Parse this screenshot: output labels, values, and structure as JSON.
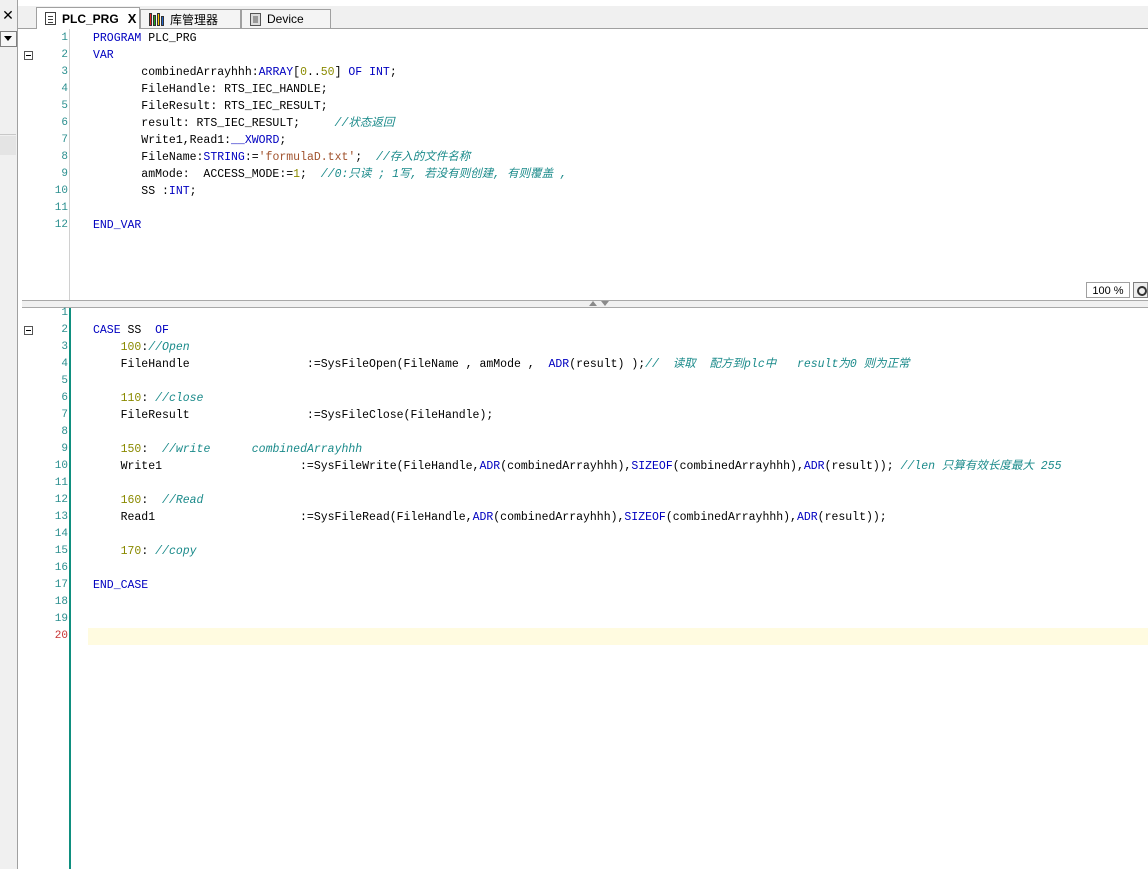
{
  "tabs": [
    {
      "label": "PLC_PRG",
      "active": true,
      "icon": "document-icon",
      "closable": true
    },
    {
      "label": "库管理器",
      "active": false,
      "icon": "library-icon"
    },
    {
      "label": "Device",
      "active": false,
      "icon": "device-icon"
    }
  ],
  "tab_close_symbol": "X",
  "left_close_symbol": "✕",
  "zoom_label": "100 %",
  "decl_lines": [
    {
      "n": "1",
      "tokens": [
        {
          "t": "PROGRAM",
          "c": "kw"
        },
        {
          "t": " PLC_PRG"
        }
      ]
    },
    {
      "n": "2",
      "fold": true,
      "tokens": [
        {
          "t": "VAR",
          "c": "kw"
        }
      ]
    },
    {
      "n": "3",
      "tokens": [
        {
          "t": "       combinedArrayhhh:"
        },
        {
          "t": "ARRAY",
          "c": "kw"
        },
        {
          "t": "["
        },
        {
          "t": "0",
          "c": "num"
        },
        {
          "t": ".."
        },
        {
          "t": "50",
          "c": "num"
        },
        {
          "t": "] "
        },
        {
          "t": "OF INT",
          "c": "kw"
        },
        {
          "t": ";"
        }
      ]
    },
    {
      "n": "4",
      "tokens": [
        {
          "t": "       FileHandle: RTS_IEC_HANDLE;"
        }
      ]
    },
    {
      "n": "5",
      "tokens": [
        {
          "t": "       FileResult: RTS_IEC_RESULT;"
        }
      ]
    },
    {
      "n": "6",
      "tokens": [
        {
          "t": "       result: RTS_IEC_RESULT;     "
        },
        {
          "t": "//状态返回",
          "c": "cm"
        }
      ]
    },
    {
      "n": "7",
      "tokens": [
        {
          "t": "       Write1,Read1:"
        },
        {
          "t": "__XWORD",
          "c": "kw"
        },
        {
          "t": ";"
        }
      ]
    },
    {
      "n": "8",
      "tokens": [
        {
          "t": "       FileName:"
        },
        {
          "t": "STRING",
          "c": "kw"
        },
        {
          "t": ":="
        },
        {
          "t": "'formulaD.txt'",
          "c": "str"
        },
        {
          "t": ";  "
        },
        {
          "t": "//存入的文件名称",
          "c": "cm"
        }
      ]
    },
    {
      "n": "9",
      "tokens": [
        {
          "t": "       amMode:  ACCESS_MODE:="
        },
        {
          "t": "1",
          "c": "num"
        },
        {
          "t": ";  "
        },
        {
          "t": "//0:只读 ; 1写, 若没有则创建, 有则覆盖 ,",
          "c": "cm"
        }
      ]
    },
    {
      "n": "10",
      "tokens": [
        {
          "t": "       SS :"
        },
        {
          "t": "INT",
          "c": "kw"
        },
        {
          "t": ";"
        }
      ]
    },
    {
      "n": "11",
      "tokens": []
    },
    {
      "n": "12",
      "tokens": [
        {
          "t": "END_VAR",
          "c": "kw"
        }
      ]
    }
  ],
  "impl_lines": [
    {
      "n": "1",
      "tokens": []
    },
    {
      "n": "2",
      "fold": true,
      "tokens": [
        {
          "t": "CASE",
          "c": "kw"
        },
        {
          "t": " SS  "
        },
        {
          "t": "OF",
          "c": "kw"
        }
      ]
    },
    {
      "n": "3",
      "tokens": [
        {
          "t": "    "
        },
        {
          "t": "100",
          "c": "num"
        },
        {
          "t": ":"
        },
        {
          "t": "//Open",
          "c": "cm"
        }
      ]
    },
    {
      "n": "4",
      "tokens": [
        {
          "t": "    FileHandle                 :=SysFileOpen(FileName , amMode ,  "
        },
        {
          "t": "ADR",
          "c": "kw"
        },
        {
          "t": "(result) );"
        },
        {
          "t": "//  读取  配方到plc中   result为0 则为正常",
          "c": "cm"
        }
      ]
    },
    {
      "n": "5",
      "tokens": []
    },
    {
      "n": "6",
      "tokens": [
        {
          "t": "    "
        },
        {
          "t": "110",
          "c": "num"
        },
        {
          "t": ": "
        },
        {
          "t": "//close",
          "c": "cm"
        }
      ]
    },
    {
      "n": "7",
      "tokens": [
        {
          "t": "    FileResult                 :=SysFileClose(FileHandle);"
        }
      ]
    },
    {
      "n": "8",
      "tokens": []
    },
    {
      "n": "9",
      "tokens": [
        {
          "t": "    "
        },
        {
          "t": "150",
          "c": "num"
        },
        {
          "t": ":  "
        },
        {
          "t": "//write      combinedArrayhhh",
          "c": "cm"
        }
      ]
    },
    {
      "n": "10",
      "tokens": [
        {
          "t": "    Write1                    :=SysFileWrite(FileHandle,"
        },
        {
          "t": "ADR",
          "c": "kw"
        },
        {
          "t": "(combinedArrayhhh),"
        },
        {
          "t": "SIZEOF",
          "c": "kw"
        },
        {
          "t": "(combinedArrayhhh),"
        },
        {
          "t": "ADR",
          "c": "kw"
        },
        {
          "t": "(result)); "
        },
        {
          "t": "//len 只算有效长度最大 255",
          "c": "cm"
        }
      ]
    },
    {
      "n": "11",
      "tokens": []
    },
    {
      "n": "12",
      "tokens": [
        {
          "t": "    "
        },
        {
          "t": "160",
          "c": "num"
        },
        {
          "t": ":  "
        },
        {
          "t": "//Read",
          "c": "cm"
        }
      ]
    },
    {
      "n": "13",
      "tokens": [
        {
          "t": "    Read1                     :=SysFileRead(FileHandle,"
        },
        {
          "t": "ADR",
          "c": "kw"
        },
        {
          "t": "(combinedArrayhhh),"
        },
        {
          "t": "SIZEOF",
          "c": "kw"
        },
        {
          "t": "(combinedArrayhhh),"
        },
        {
          "t": "ADR",
          "c": "kw"
        },
        {
          "t": "(result));"
        }
      ]
    },
    {
      "n": "14",
      "tokens": []
    },
    {
      "n": "15",
      "tokens": [
        {
          "t": "    "
        },
        {
          "t": "170",
          "c": "num"
        },
        {
          "t": ": "
        },
        {
          "t": "//copy",
          "c": "cm"
        }
      ]
    },
    {
      "n": "16",
      "tokens": []
    },
    {
      "n": "17",
      "tokens": [
        {
          "t": "END_CASE",
          "c": "kw"
        }
      ]
    },
    {
      "n": "18",
      "tokens": []
    },
    {
      "n": "19",
      "tokens": []
    },
    {
      "n": "20",
      "current": true,
      "tokens": []
    }
  ],
  "colors": {
    "keyword": "#0000c0",
    "number": "#8a8a00",
    "string": "#a0522d",
    "comment": "#1a8a8a",
    "line_number": "#2b8f8f",
    "current_line_number": "#c83232",
    "current_line_bg": "#fffbe0"
  }
}
